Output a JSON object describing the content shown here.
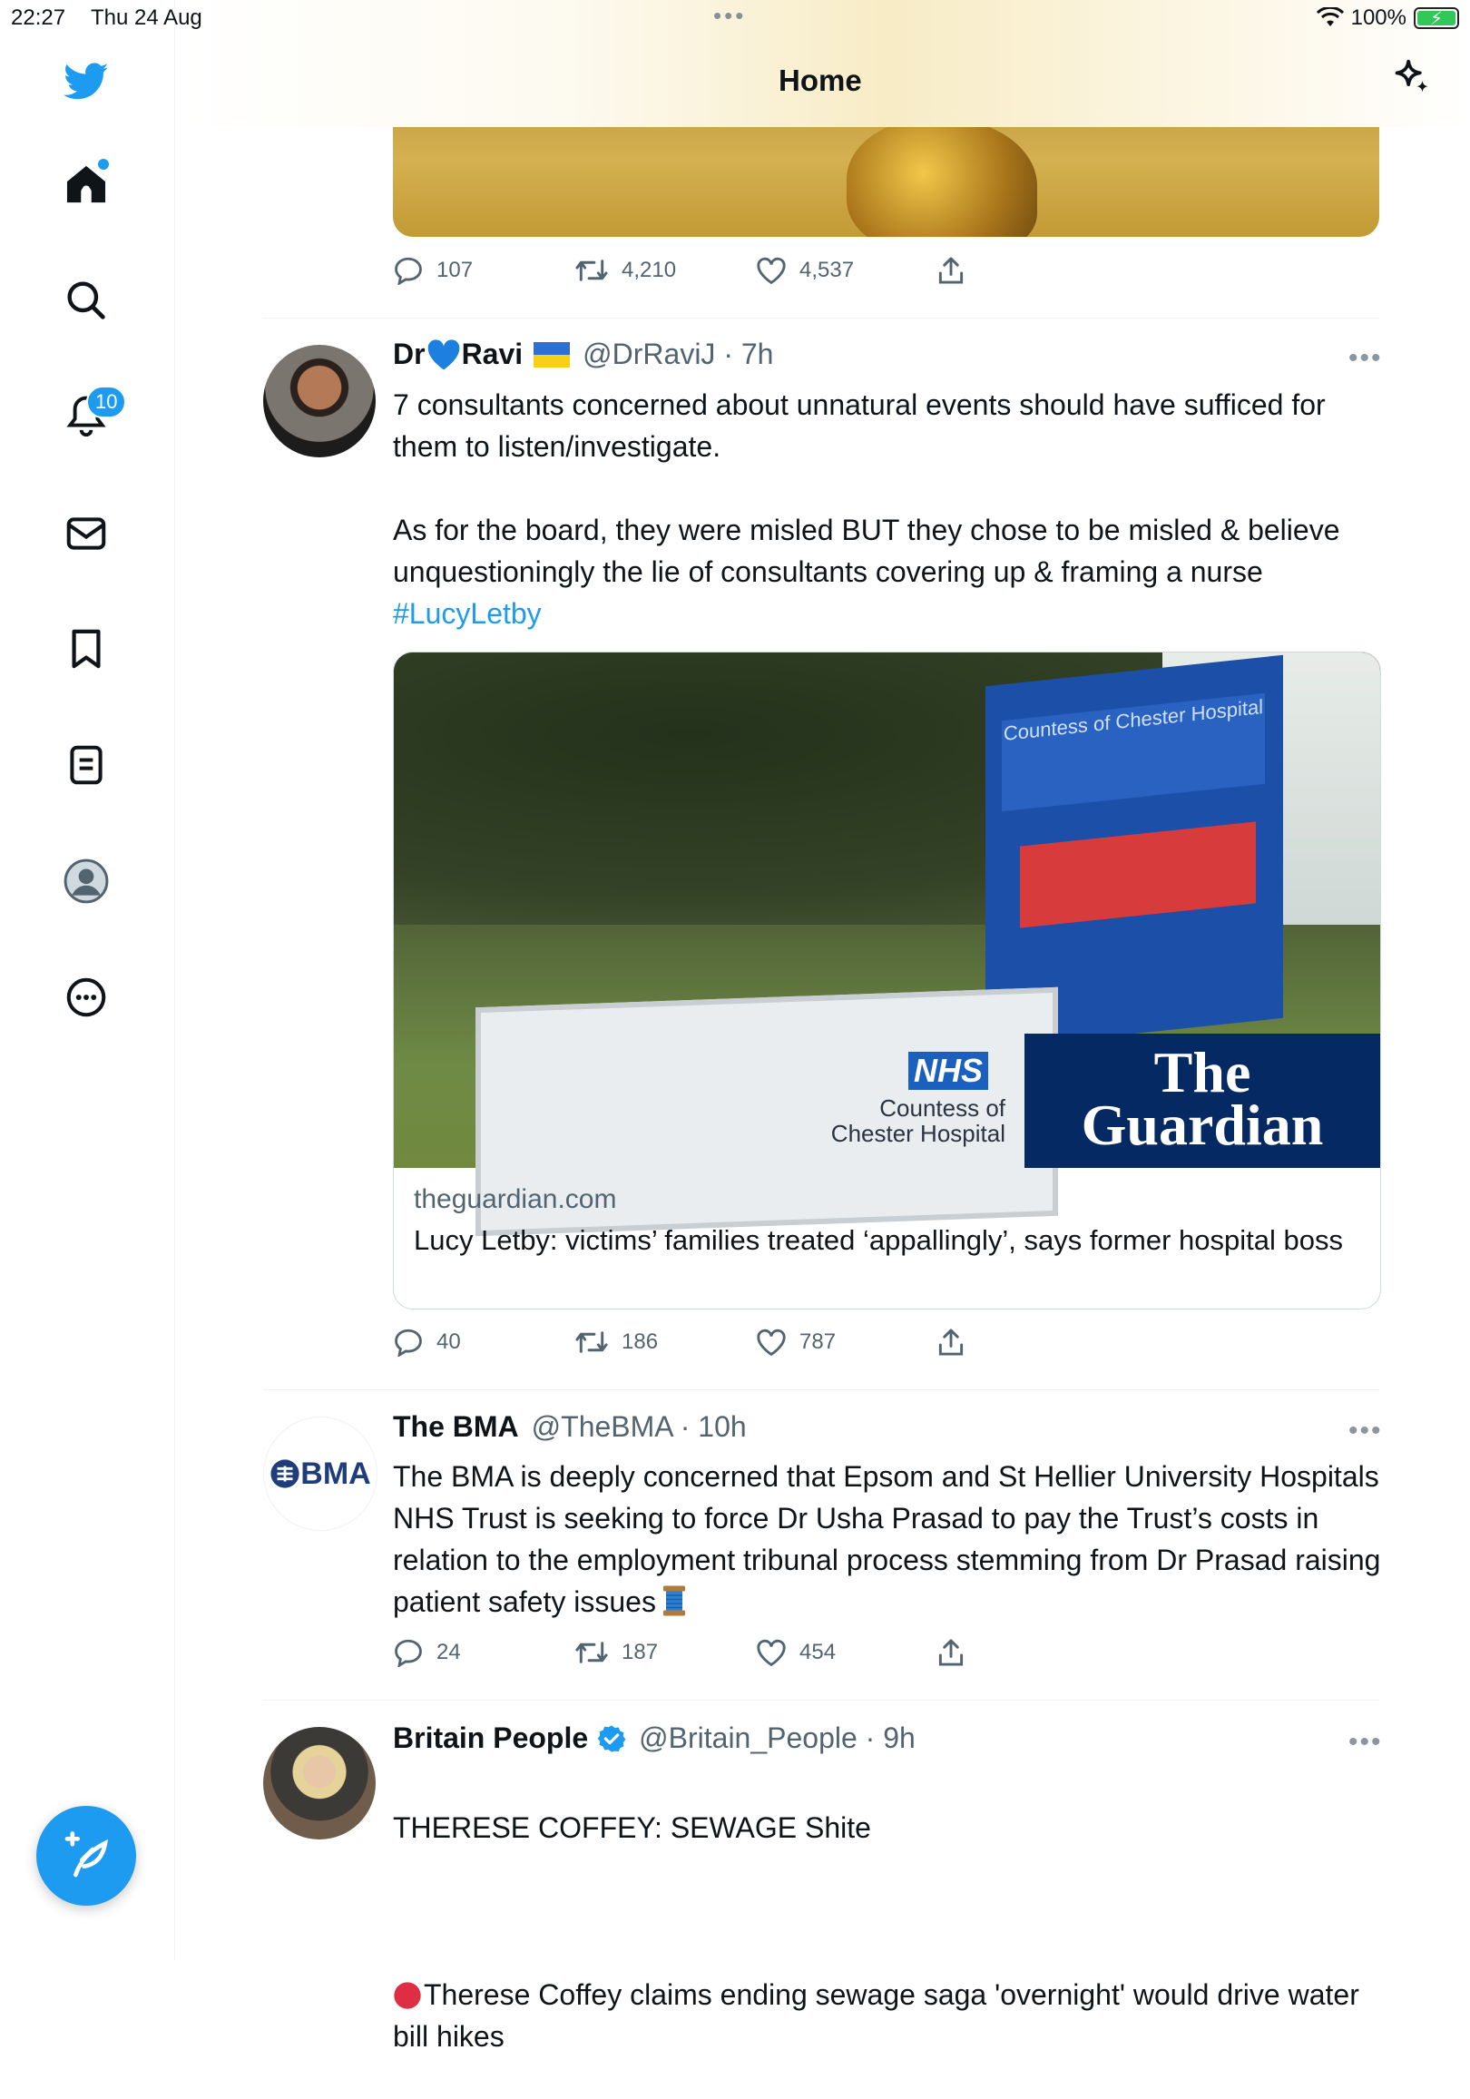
{
  "status_bar": {
    "time": "22:27",
    "date": "Thu 24 Aug",
    "battery": "100%"
  },
  "header": {
    "title": "Home"
  },
  "sidebar": {
    "notifications_badge": "10"
  },
  "prev_tweet": {
    "replies": "107",
    "retweets": "4,210",
    "likes": "4,537"
  },
  "tweets": [
    {
      "name_prefix": "Dr",
      "name_suffix": "Ravi",
      "handle": "@DrRaviJ · 7h",
      "body": "7 consultants concerned about unnatural events should have sufficed for them to listen/investigate.\n\nAs for the board, they were misled BUT they chose to be misled & believe unquestioningly the lie of consultants covering up & framing a nurse",
      "hashtag": "#LucyLetby",
      "card": {
        "domain": "theguardian.com",
        "headline": "Lucy Letby: victims’ families treated ‘appallingly’, says former hospital boss",
        "photo_nhs": "NHS",
        "photo_hospital": "Countess of Chester Hospital",
        "photo_sign": "Countess of Chester Hospital",
        "photo_brand_line1": "The",
        "photo_brand_line2": "Guardian"
      },
      "replies": "40",
      "retweets": "186",
      "likes": "787"
    },
    {
      "name": "The BMA",
      "handle": "@TheBMA · 10h",
      "avatar_text": "BMA",
      "body": "The BMA is deeply concerned that Epsom and St Hellier University Hospitals NHS Trust is seeking to force Dr Usha Prasad to pay the Trust’s costs in relation to the employment tribunal process stemming from Dr Prasad raising patient safety issues",
      "replies": "24",
      "retweets": "187",
      "likes": "454"
    },
    {
      "name": "Britain People",
      "handle": "@Britain_People · 9h",
      "body_line1": "THERESE COFFEY: SEWAGE Shite",
      "body_line2": "Therese Coffey claims ending sewage saga 'overnight' would drive water bill hikes"
    }
  ],
  "colors": {
    "accent": "#1d9bf0",
    "text": "#0f1419",
    "muted": "#536471"
  }
}
